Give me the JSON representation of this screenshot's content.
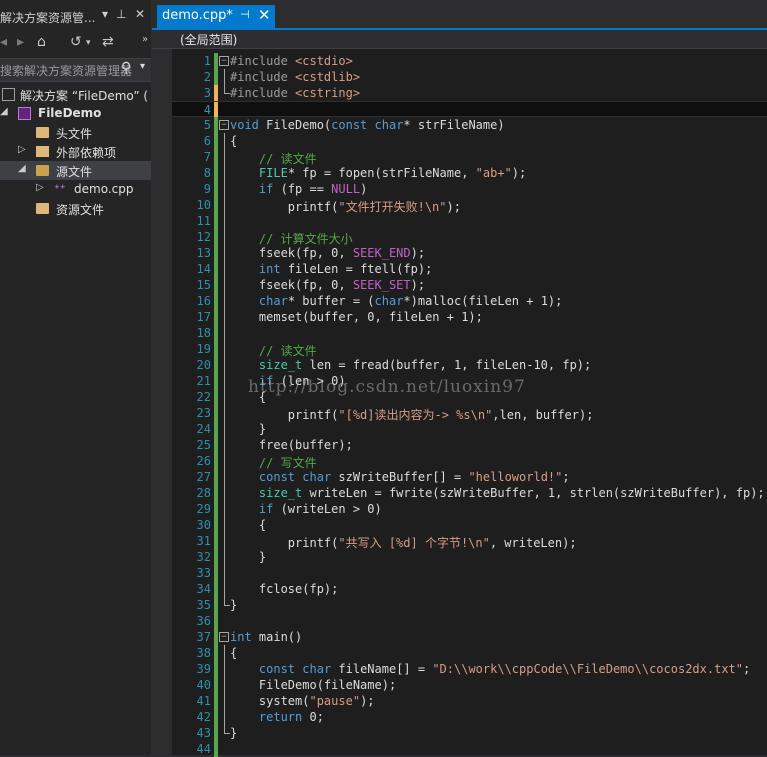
{
  "solution_explorer": {
    "title": "解决方案资源管...",
    "search_placeholder": "搜索解决方案资源管理器",
    "tree": [
      {
        "label": "解决方案 “FileDemo” (",
        "icon": "solution-icon",
        "indent": 0,
        "arrow": "",
        "selected": false
      },
      {
        "label": "FileDemo",
        "icon": "project-icon",
        "indent": 1,
        "arrow": "◢",
        "selected": false,
        "bold": true
      },
      {
        "label": "头文件",
        "icon": "folder-icon",
        "indent": 2,
        "arrow": "",
        "selected": false
      },
      {
        "label": "外部依赖项",
        "icon": "dependencies-icon",
        "indent": 2,
        "arrow": "▷",
        "selected": false
      },
      {
        "label": "源文件",
        "icon": "folder-open-icon",
        "indent": 2,
        "arrow": "◢",
        "selected": true
      },
      {
        "label": "demo.cpp",
        "icon": "cpp-file-icon",
        "indent": 3,
        "arrow": "▷",
        "selected": false
      },
      {
        "label": "资源文件",
        "icon": "folder-icon",
        "indent": 2,
        "arrow": "",
        "selected": false
      }
    ]
  },
  "editor": {
    "tab_label": "demo.cpp*",
    "scope": "(全局范围)",
    "current_line": 4,
    "lines": [
      {
        "n": "1",
        "bar": "g",
        "fold": "start",
        "t": [
          [
            "pp",
            "#include "
          ],
          [
            "inc",
            "<cstdio>"
          ]
        ]
      },
      {
        "n": "2",
        "bar": "g",
        "fold": "line",
        "t": [
          [
            "pp",
            "#include "
          ],
          [
            "inc",
            "<cstdlib>"
          ]
        ]
      },
      {
        "n": "3",
        "bar": "m",
        "fold": "end",
        "t": [
          [
            "pp",
            "#include "
          ],
          [
            "inc",
            "<cstring>"
          ]
        ]
      },
      {
        "n": "4",
        "bar": "m",
        "fold": "",
        "t": []
      },
      {
        "n": "5",
        "bar": "g",
        "fold": "start",
        "t": [
          [
            "kw",
            "void"
          ],
          [
            "txt",
            " FileDemo("
          ],
          [
            "kw",
            "const"
          ],
          [
            "txt",
            " "
          ],
          [
            "kw",
            "char"
          ],
          [
            "txt",
            "* strFileName)"
          ]
        ]
      },
      {
        "n": "6",
        "bar": "g",
        "fold": "line",
        "t": [
          [
            "txt",
            "{"
          ]
        ]
      },
      {
        "n": "7",
        "bar": "g",
        "fold": "line",
        "t": [
          [
            "txt",
            "    "
          ],
          [
            "com",
            "// 读文件"
          ]
        ]
      },
      {
        "n": "8",
        "bar": "g",
        "fold": "line",
        "t": [
          [
            "txt",
            "    "
          ],
          [
            "typ",
            "FILE"
          ],
          [
            "txt",
            "* fp = fopen(strFileName, "
          ],
          [
            "str",
            "\"ab+\""
          ],
          [
            "txt",
            ");"
          ]
        ]
      },
      {
        "n": "9",
        "bar": "g",
        "fold": "line",
        "t": [
          [
            "txt",
            "    "
          ],
          [
            "kw",
            "if"
          ],
          [
            "txt",
            " (fp == "
          ],
          [
            "mac",
            "NULL"
          ],
          [
            "txt",
            ")"
          ]
        ]
      },
      {
        "n": "10",
        "bar": "g",
        "fold": "line",
        "t": [
          [
            "txt",
            "        printf("
          ],
          [
            "str",
            "\"文件打开失败!\\n\""
          ],
          [
            "txt",
            ");"
          ]
        ]
      },
      {
        "n": "11",
        "bar": "g",
        "fold": "line",
        "t": []
      },
      {
        "n": "12",
        "bar": "g",
        "fold": "line",
        "t": [
          [
            "txt",
            "    "
          ],
          [
            "com",
            "// 计算文件大小"
          ]
        ]
      },
      {
        "n": "13",
        "bar": "g",
        "fold": "line",
        "t": [
          [
            "txt",
            "    fseek(fp, 0, "
          ],
          [
            "mac",
            "SEEK_END"
          ],
          [
            "txt",
            ");"
          ]
        ]
      },
      {
        "n": "14",
        "bar": "g",
        "fold": "line",
        "t": [
          [
            "txt",
            "    "
          ],
          [
            "kw",
            "int"
          ],
          [
            "txt",
            " fileLen = ftell(fp);"
          ]
        ]
      },
      {
        "n": "15",
        "bar": "g",
        "fold": "line",
        "t": [
          [
            "txt",
            "    fseek(fp, 0, "
          ],
          [
            "mac",
            "SEEK_SET"
          ],
          [
            "txt",
            ");"
          ]
        ]
      },
      {
        "n": "16",
        "bar": "g",
        "fold": "line",
        "t": [
          [
            "txt",
            "    "
          ],
          [
            "kw",
            "char"
          ],
          [
            "txt",
            "* buffer = ("
          ],
          [
            "kw",
            "char"
          ],
          [
            "txt",
            "*)malloc(fileLen + 1);"
          ]
        ]
      },
      {
        "n": "17",
        "bar": "g",
        "fold": "line",
        "t": [
          [
            "txt",
            "    memset(buffer, 0, fileLen + 1);"
          ]
        ]
      },
      {
        "n": "18",
        "bar": "g",
        "fold": "line",
        "t": []
      },
      {
        "n": "19",
        "bar": "g",
        "fold": "line",
        "t": [
          [
            "txt",
            "    "
          ],
          [
            "com",
            "// 读文件"
          ]
        ]
      },
      {
        "n": "20",
        "bar": "g",
        "fold": "line",
        "t": [
          [
            "txt",
            "    "
          ],
          [
            "typ",
            "size_t"
          ],
          [
            "txt",
            " len = fread(buffer, 1, fileLen-10, fp);"
          ]
        ]
      },
      {
        "n": "21",
        "bar": "g",
        "fold": "line",
        "t": [
          [
            "txt",
            "    "
          ],
          [
            "kw",
            "if"
          ],
          [
            "txt",
            " (len > 0)"
          ]
        ]
      },
      {
        "n": "22",
        "bar": "g",
        "fold": "line",
        "t": [
          [
            "txt",
            "    {"
          ]
        ]
      },
      {
        "n": "23",
        "bar": "g",
        "fold": "line",
        "t": [
          [
            "txt",
            "        printf("
          ],
          [
            "str",
            "\"[%d]读出内容为-> %s\\n\""
          ],
          [
            "txt",
            ",len, buffer);"
          ]
        ]
      },
      {
        "n": "24",
        "bar": "g",
        "fold": "line",
        "t": [
          [
            "txt",
            "    }"
          ]
        ]
      },
      {
        "n": "25",
        "bar": "g",
        "fold": "line",
        "t": [
          [
            "txt",
            "    free(buffer);"
          ]
        ]
      },
      {
        "n": "26",
        "bar": "g",
        "fold": "line",
        "t": [
          [
            "txt",
            "    "
          ],
          [
            "com",
            "// 写文件"
          ]
        ]
      },
      {
        "n": "27",
        "bar": "g",
        "fold": "line",
        "t": [
          [
            "txt",
            "    "
          ],
          [
            "kw",
            "const"
          ],
          [
            "txt",
            " "
          ],
          [
            "kw",
            "char"
          ],
          [
            "txt",
            " szWriteBuffer[] = "
          ],
          [
            "str",
            "\"helloworld!\""
          ],
          [
            "txt",
            ";"
          ]
        ]
      },
      {
        "n": "28",
        "bar": "g",
        "fold": "line",
        "t": [
          [
            "txt",
            "    "
          ],
          [
            "typ",
            "size_t"
          ],
          [
            "txt",
            " writeLen = fwrite(szWriteBuffer, 1, strlen(szWriteBuffer), fp);"
          ]
        ]
      },
      {
        "n": "29",
        "bar": "g",
        "fold": "line",
        "t": [
          [
            "txt",
            "    "
          ],
          [
            "kw",
            "if"
          ],
          [
            "txt",
            " (writeLen > 0)"
          ]
        ]
      },
      {
        "n": "30",
        "bar": "g",
        "fold": "line",
        "t": [
          [
            "txt",
            "    {"
          ]
        ]
      },
      {
        "n": "31",
        "bar": "g",
        "fold": "line",
        "t": [
          [
            "txt",
            "        printf("
          ],
          [
            "str",
            "\"共写入 [%d] 个字节!\\n\""
          ],
          [
            "txt",
            ", writeLen);"
          ]
        ]
      },
      {
        "n": "32",
        "bar": "g",
        "fold": "line",
        "t": [
          [
            "txt",
            "    }"
          ]
        ]
      },
      {
        "n": "33",
        "bar": "g",
        "fold": "line",
        "t": []
      },
      {
        "n": "34",
        "bar": "g",
        "fold": "line",
        "t": [
          [
            "txt",
            "    fclose(fp);"
          ]
        ]
      },
      {
        "n": "35",
        "bar": "g",
        "fold": "end",
        "t": [
          [
            "txt",
            "}"
          ]
        ]
      },
      {
        "n": "36",
        "bar": "g",
        "fold": "",
        "t": []
      },
      {
        "n": "37",
        "bar": "g",
        "fold": "start",
        "t": [
          [
            "kw",
            "int"
          ],
          [
            "txt",
            " main()"
          ]
        ]
      },
      {
        "n": "38",
        "bar": "g",
        "fold": "line",
        "t": [
          [
            "txt",
            "{"
          ]
        ]
      },
      {
        "n": "39",
        "bar": "g",
        "fold": "line",
        "t": [
          [
            "txt",
            "    "
          ],
          [
            "kw",
            "const"
          ],
          [
            "txt",
            " "
          ],
          [
            "kw",
            "char"
          ],
          [
            "txt",
            " fileName[] = "
          ],
          [
            "str",
            "\"D:\\\\work\\\\cppCode\\\\FileDemo\\\\cocos2dx.txt\""
          ],
          [
            "txt",
            ";"
          ]
        ]
      },
      {
        "n": "40",
        "bar": "g",
        "fold": "line",
        "t": [
          [
            "txt",
            "    FileDemo(fileName);"
          ]
        ]
      },
      {
        "n": "41",
        "bar": "g",
        "fold": "line",
        "t": [
          [
            "txt",
            "    system("
          ],
          [
            "str",
            "\"pause\""
          ],
          [
            "txt",
            ");"
          ]
        ]
      },
      {
        "n": "42",
        "bar": "g",
        "fold": "line",
        "t": [
          [
            "txt",
            "    "
          ],
          [
            "kw",
            "return"
          ],
          [
            "txt",
            " 0;"
          ]
        ]
      },
      {
        "n": "43",
        "bar": "g",
        "fold": "end",
        "t": [
          [
            "txt",
            "}"
          ]
        ]
      },
      {
        "n": "44",
        "bar": "g",
        "fold": "",
        "t": []
      }
    ]
  },
  "watermark": "http://blog.csdn.net/luoxin97"
}
